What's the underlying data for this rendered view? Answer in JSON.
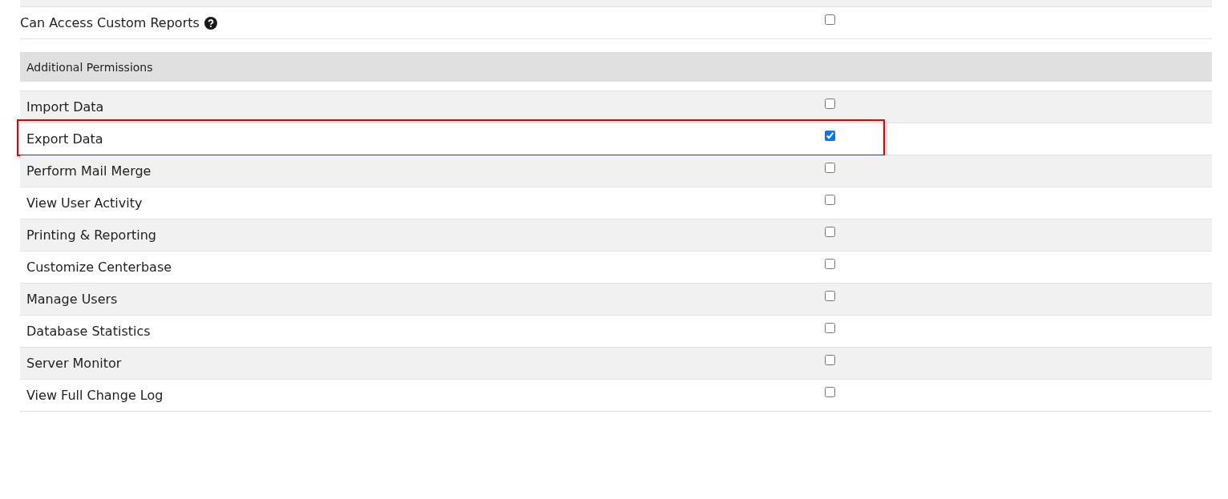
{
  "top_permission": {
    "label": "Can Access Custom Reports",
    "checked": false
  },
  "section": {
    "title": "Additional Permissions",
    "rows": [
      {
        "label": "Import Data",
        "checked": false,
        "highlighted": false
      },
      {
        "label": "Export Data",
        "checked": true,
        "highlighted": true
      },
      {
        "label": "Perform Mail Merge",
        "checked": false,
        "highlighted": false
      },
      {
        "label": "View User Activity",
        "checked": false,
        "highlighted": false
      },
      {
        "label": "Printing & Reporting",
        "checked": false,
        "highlighted": false
      },
      {
        "label": "Customize Centerbase",
        "checked": false,
        "highlighted": false
      },
      {
        "label": "Manage Users",
        "checked": false,
        "highlighted": false
      },
      {
        "label": "Database Statistics",
        "checked": false,
        "highlighted": false
      },
      {
        "label": "Server Monitor",
        "checked": false,
        "highlighted": false
      },
      {
        "label": "View Full Change Log",
        "checked": false,
        "highlighted": false
      }
    ]
  }
}
